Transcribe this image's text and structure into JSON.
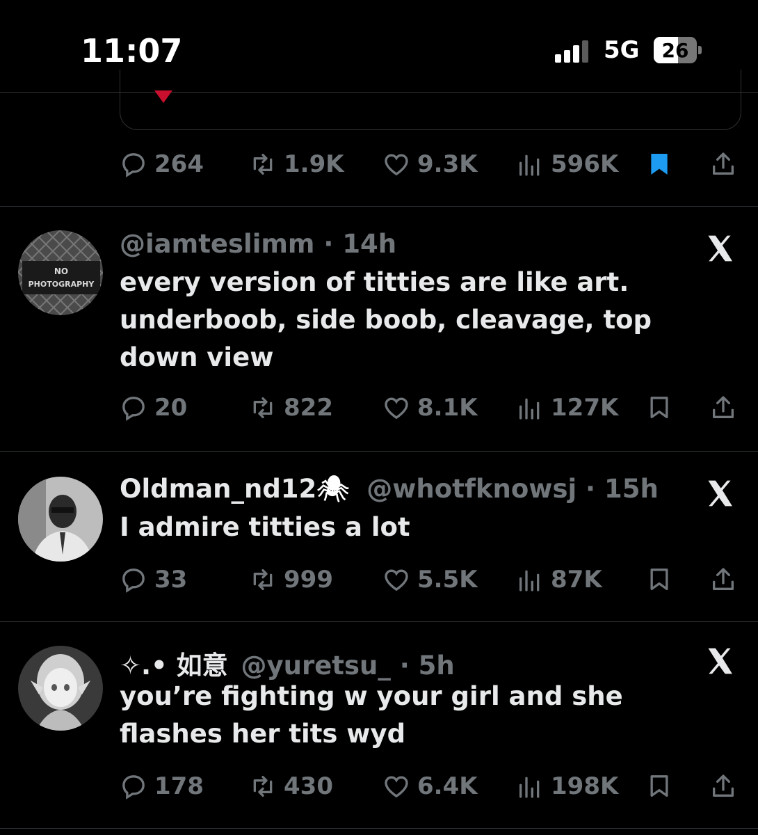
{
  "status_bar": {
    "time": "11:07",
    "network": "5G",
    "battery": {
      "level_text": "26",
      "level_fraction": 0.26
    }
  },
  "icons": {
    "reply": "reply-icon",
    "repost": "repost-icon",
    "like": "like-icon",
    "views": "views-icon",
    "bookmark": "bookmark-icon",
    "share": "share-icon",
    "x_logo": "x-logo-icon"
  },
  "colors": {
    "background": "#000000",
    "text": "#e7e9ea",
    "muted": "#71767b",
    "accent": "#1d9bf0",
    "divider": "#2f3336"
  },
  "top_tweet": {
    "stats": {
      "replies": "264",
      "reposts": "1.9K",
      "likes": "9.3K",
      "views": "596K"
    },
    "bookmarked": true
  },
  "tweets": [
    {
      "display_name": "",
      "handle": "@iamteslimm",
      "time": "14h",
      "text": "every version of titties are like art. underboob, side boob, cleavage, top down view",
      "avatar_sign_lines": [
        "NO",
        "PHOTOGRAPHY"
      ],
      "stats": {
        "replies": "20",
        "reposts": "822",
        "likes": "8.1K",
        "views": "127K"
      }
    },
    {
      "display_name": "Oldman_nd12",
      "display_emoji": "🕷",
      "handle": "@whotfknowsj",
      "time": "15h",
      "text": "I admire titties a lot",
      "stats": {
        "replies": "33",
        "reposts": "999",
        "likes": "5.5K",
        "views": "87K"
      }
    },
    {
      "display_name": "✧.• 如意",
      "handle": "@yuretsu_",
      "time": "5h",
      "text": "you’re fighting w your girl and she flashes her tits wyd",
      "stats": {
        "replies": "178",
        "reposts": "430",
        "likes": "6.4K",
        "views": "198K"
      }
    }
  ]
}
